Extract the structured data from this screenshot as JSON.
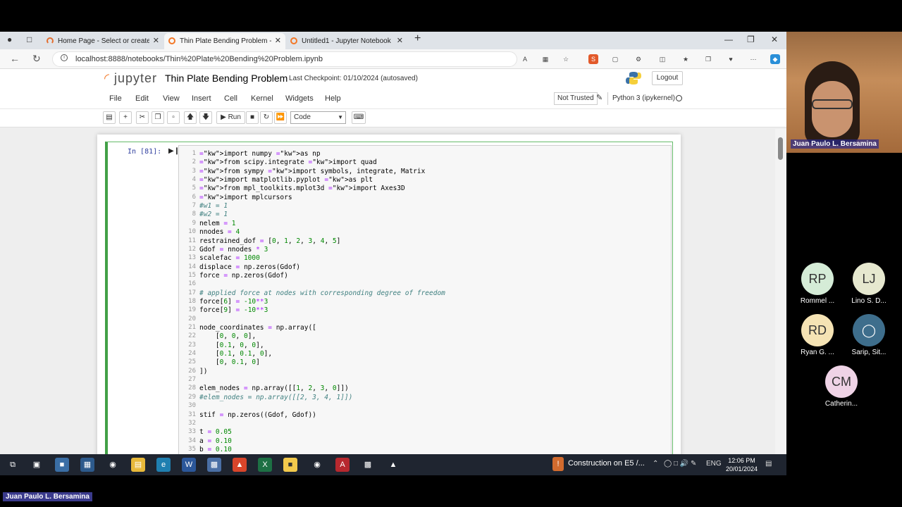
{
  "browser": {
    "tabs": [
      {
        "title": "Home Page - Select or create a n"
      },
      {
        "title": "Thin Plate Bending Problem - Jup"
      },
      {
        "title": "Untitled1 - Jupyter Notebook"
      }
    ],
    "url": "localhost:8888/notebooks/Thin%20Plate%20Bending%20Problem.ipynb"
  },
  "jupyter": {
    "logo_text": "jupyter",
    "notebook_name": "Thin Plate Bending Problem",
    "checkpoint": "Last Checkpoint: 01/10/2024  (autosaved)",
    "logout_label": "Logout",
    "menu": [
      "File",
      "Edit",
      "View",
      "Insert",
      "Cell",
      "Kernel",
      "Widgets",
      "Help"
    ],
    "trust_label": "Not Trusted",
    "kernel_name": "Python 3 (ipykernel)",
    "run_label": "Run",
    "cell_type": "Code",
    "prompt": "In [81]:"
  },
  "code_lines": [
    "import numpy as np",
    "from scipy.integrate import quad",
    "from sympy import symbols, integrate, Matrix",
    "import matplotlib.pyplot as plt",
    "from mpl_toolkits.mplot3d import Axes3D",
    "import mplcursors",
    "#w1 = 1",
    "#w2 = 1",
    "nelem = 1",
    "nnodes = 4",
    "restrained_dof = [0, 1, 2, 3, 4, 5]",
    "Gdof = nnodes * 3",
    "scalefac = 1000",
    "displace = np.zeros(Gdof)",
    "force = np.zeros(Gdof)",
    "",
    "# applied force at nodes with corresponding degree of freedom",
    "force[6] = -10**3",
    "force[9] = -10**3",
    "",
    "node_coordinates = np.array([",
    "    [0, 0, 0],",
    "    [0.1, 0, 0],",
    "    [0.1, 0.1, 0],",
    "    [0, 0.1, 0]",
    "])",
    "",
    "elem_nodes = np.array([[1, 2, 3, 0]])",
    "#elem_nodes = np.array([[2, 3, 4, 1]])",
    "",
    "stif = np.zeros((Gdof, Gdof))",
    "",
    "t = 0.05",
    "a = 0.10",
    "b = 0.10"
  ],
  "taskbar": {
    "news": "Construction on E5 /...",
    "lang": "ENG",
    "time": "12:06 PM",
    "date": "20/01/2024"
  },
  "call": {
    "speaker": "Juan Paulo L. Bersamina",
    "participants": [
      {
        "initials": "RP",
        "name": "Rommel ...",
        "color": "#d5ecd7"
      },
      {
        "initials": "LJ",
        "name": "Lino S. D...",
        "color": "#e6e8cf"
      },
      {
        "initials": "RD",
        "name": "Ryan G. ...",
        "color": "#f5e3b4"
      },
      {
        "initials": "",
        "name": "Sarip, Sit...",
        "color": "#3e6e8c"
      },
      {
        "initials": "CM",
        "name": "Catherin...",
        "color": "#efd3e6"
      }
    ],
    "bottom_name": "Juan Paulo L. Bersamina"
  }
}
